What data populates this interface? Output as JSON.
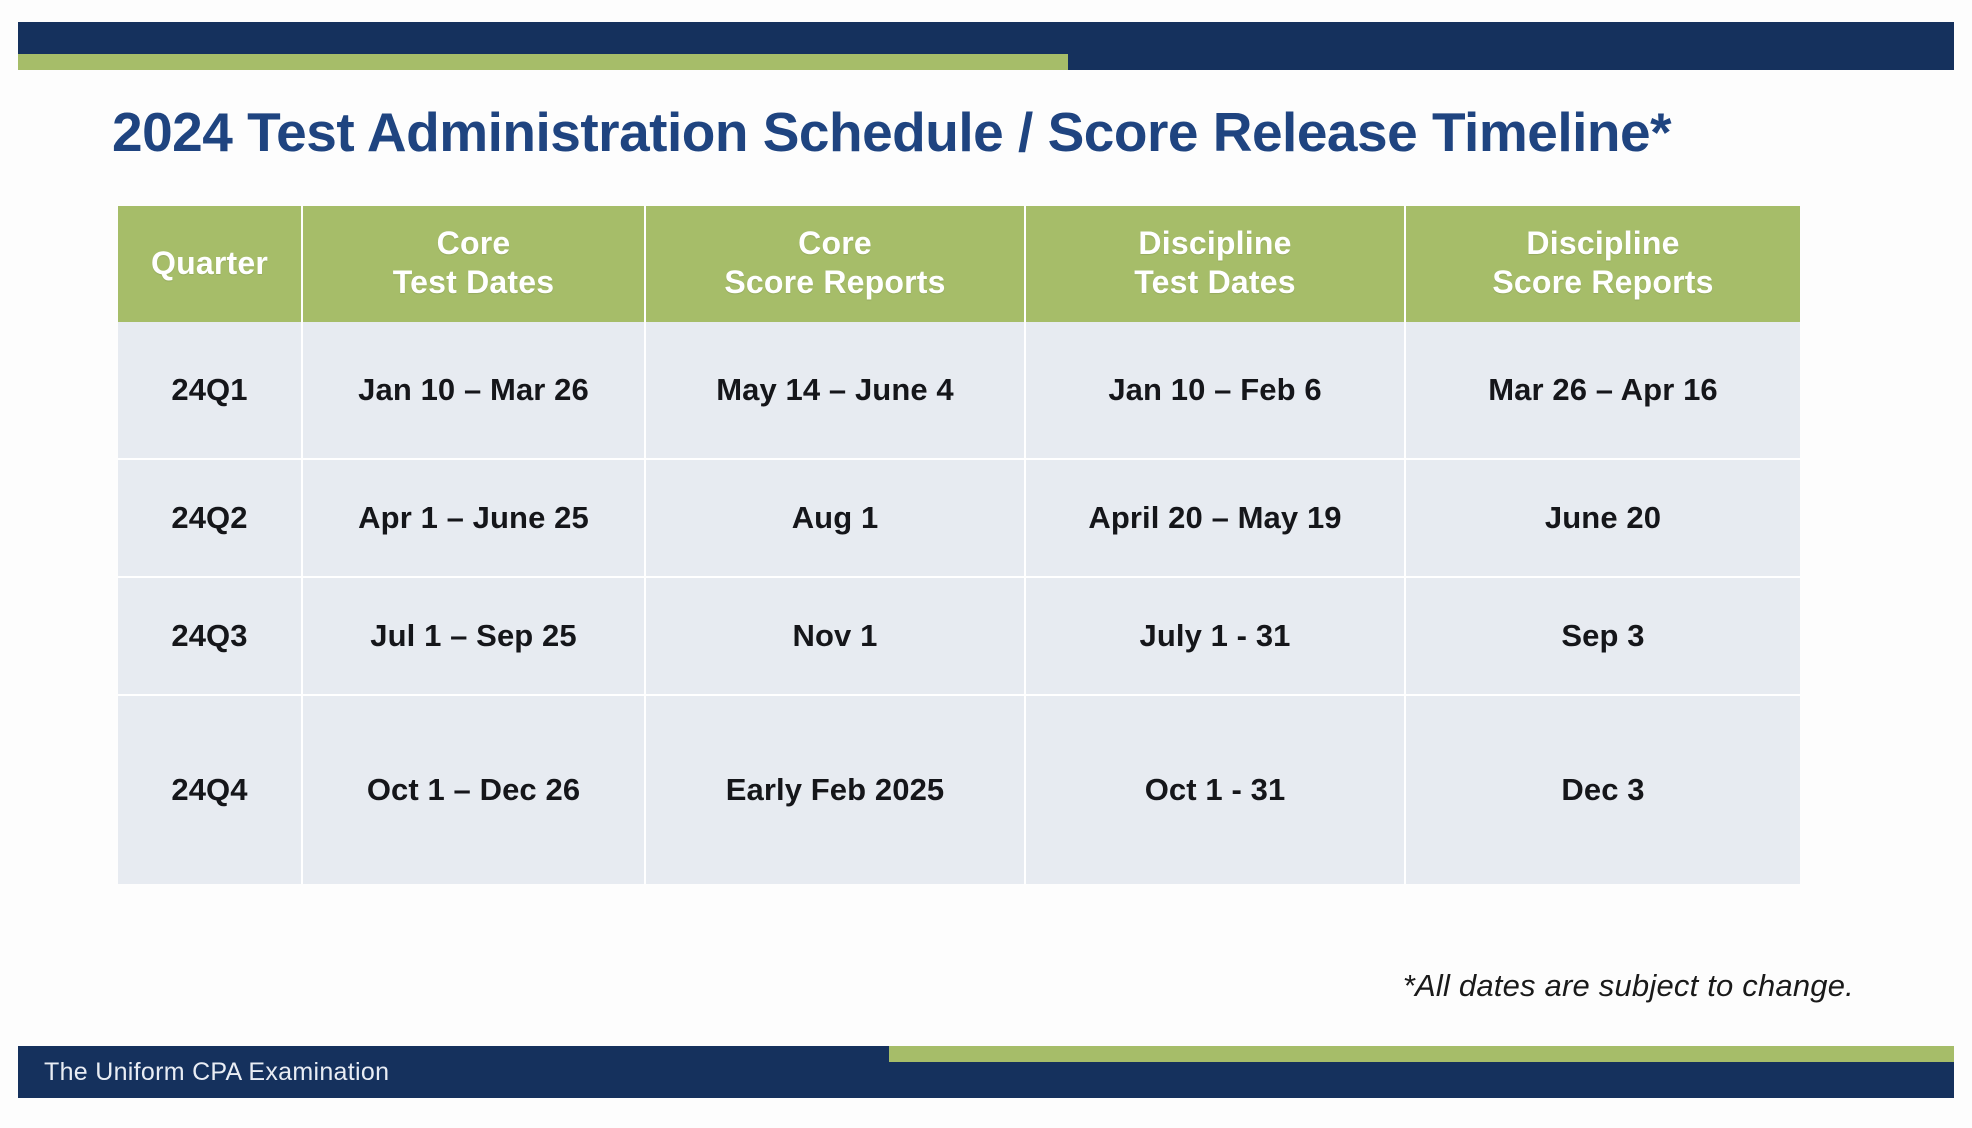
{
  "colors": {
    "navy": "#15315d",
    "green": "#a6bd69",
    "title_blue": "#1f4480",
    "cell_bg": "#e7ebf1",
    "grid_white": "#ffffff"
  },
  "header": {
    "accent_top_bar": "navy-bar",
    "accent_green_strip": "green-strip"
  },
  "title": "2024 Test Administration Schedule / Score Release Timeline*",
  "table": {
    "columns": [
      {
        "line1": "Quarter",
        "line2": ""
      },
      {
        "line1": "Core",
        "line2": "Test Dates"
      },
      {
        "line1": "Core",
        "line2": "Score Reports"
      },
      {
        "line1": "Discipline",
        "line2": "Test Dates"
      },
      {
        "line1": "Discipline",
        "line2": "Score Reports"
      }
    ],
    "rows": [
      {
        "quarter": "24Q1",
        "core_test_dates": "Jan 10 – Mar 26",
        "core_score_reports": "May 14 – June 4",
        "discipline_test_dates": "Jan 10 – Feb 6",
        "discipline_score_reports": "Mar 26 – Apr 16"
      },
      {
        "quarter": "24Q2",
        "core_test_dates": "Apr 1 – June 25",
        "core_score_reports": "Aug 1",
        "discipline_test_dates": "April 20  – May 19",
        "discipline_score_reports": "June 20"
      },
      {
        "quarter": "24Q3",
        "core_test_dates": "Jul 1 – Sep 25",
        "core_score_reports": "Nov 1",
        "discipline_test_dates": "July 1  - 31",
        "discipline_score_reports": "Sep 3"
      },
      {
        "quarter": "24Q4",
        "core_test_dates": "Oct 1 – Dec 26",
        "core_score_reports": "Early Feb 2025",
        "discipline_test_dates": "Oct 1 - 31",
        "discipline_score_reports": "Dec 3"
      }
    ]
  },
  "footnote": "*All dates are subject to change.",
  "footer": {
    "label": "The Uniform CPA Examination"
  }
}
